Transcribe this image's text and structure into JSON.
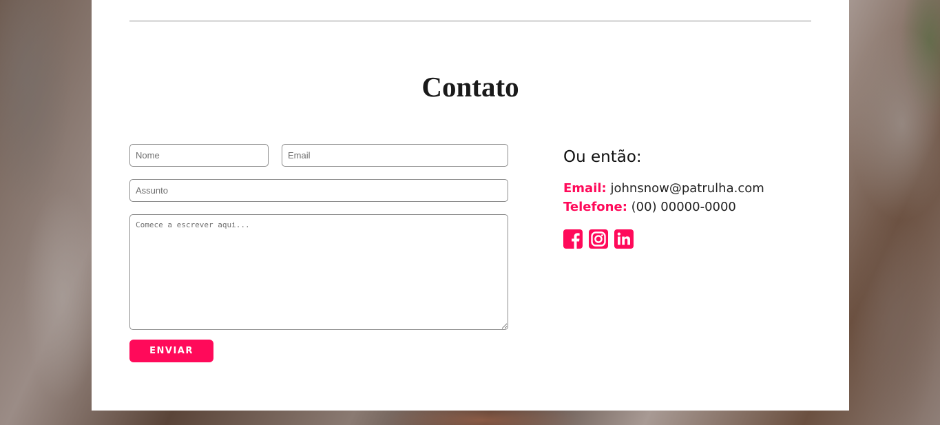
{
  "section": {
    "title": "Contato"
  },
  "form": {
    "name_placeholder": "Nome",
    "email_placeholder": "Email",
    "subject_placeholder": "Assunto",
    "message_placeholder": "Comece a escrever aqui...",
    "submit_label": "ENVIAR"
  },
  "contact": {
    "heading": "Ou então:",
    "email_label": "Email:",
    "email_value": "johnsnow@patrulha.com",
    "phone_label": "Telefone:",
    "phone_value": "(00) 00000-0000",
    "social_icons": [
      "facebook-icon",
      "instagram-icon",
      "linkedin-icon"
    ]
  },
  "colors": {
    "accent": "#ff0a5a",
    "page_bg": "#ffffff",
    "text": "#1a1a1a"
  }
}
